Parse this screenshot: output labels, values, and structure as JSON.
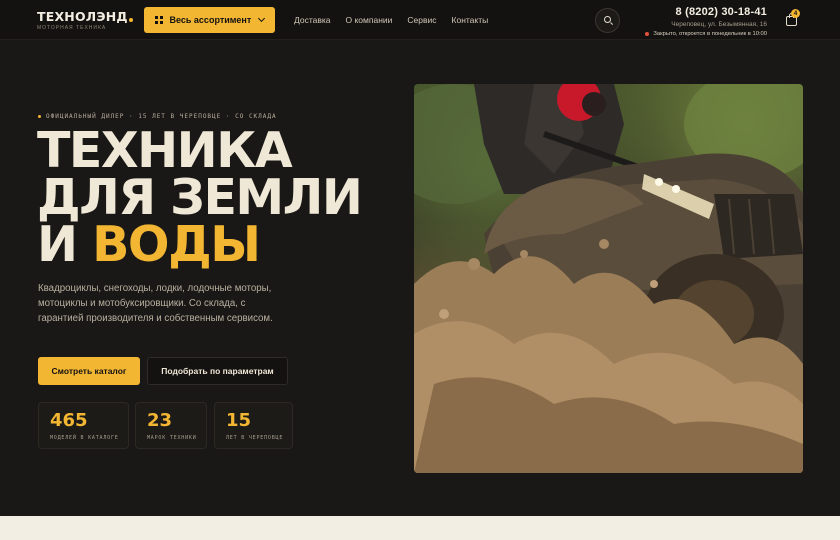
{
  "header": {
    "logo": {
      "name": "ТЕХНОЛЭНД",
      "tagline": "Моторная техника"
    },
    "catalog_button": "Весь ассортимент",
    "nav": [
      {
        "label": "Доставка"
      },
      {
        "label": "О компании"
      },
      {
        "label": "Сервис"
      },
      {
        "label": "Контакты"
      }
    ],
    "phone": "8 (8202) 30-18-41",
    "address": "Череповец, ул. Безымянная, 16",
    "hours": "Закрыто, откроется в понедельник в 10:00",
    "cart_count": "4",
    "icons": [
      "grid-icon",
      "chevron-down-icon",
      "search-icon",
      "cart-icon"
    ]
  },
  "hero": {
    "eyebrow": "Официальный дилер · 15 лет в Череповце · со склада",
    "headline_line1": "ТЕХНИКА",
    "headline_line2": "ДЛЯ ЗЕМЛИ",
    "headline_line3_prefix": "И ",
    "headline_line3_accent": "ВОДЫ",
    "lead": "Квадроциклы, снегоходы, лодки, лодочные моторы, мотоциклы и мотобуксировщики. Со склада, с гарантией производителя и собственным сервисом.",
    "primary_button": "Смотреть каталог",
    "secondary_button": "Подобрать по параметрам",
    "stats": [
      {
        "value": "465",
        "label": "моделей в каталоге"
      },
      {
        "value": "23",
        "label": "марок техники"
      },
      {
        "value": "15",
        "label": "лет в Череповце"
      }
    ],
    "image": "atv-in-mud-photo"
  },
  "colors": {
    "accent": "#f2b632",
    "background": "#1a1816",
    "header_bg": "#141210",
    "text_light": "#efe7d6",
    "status_closed": "#e0533b"
  }
}
